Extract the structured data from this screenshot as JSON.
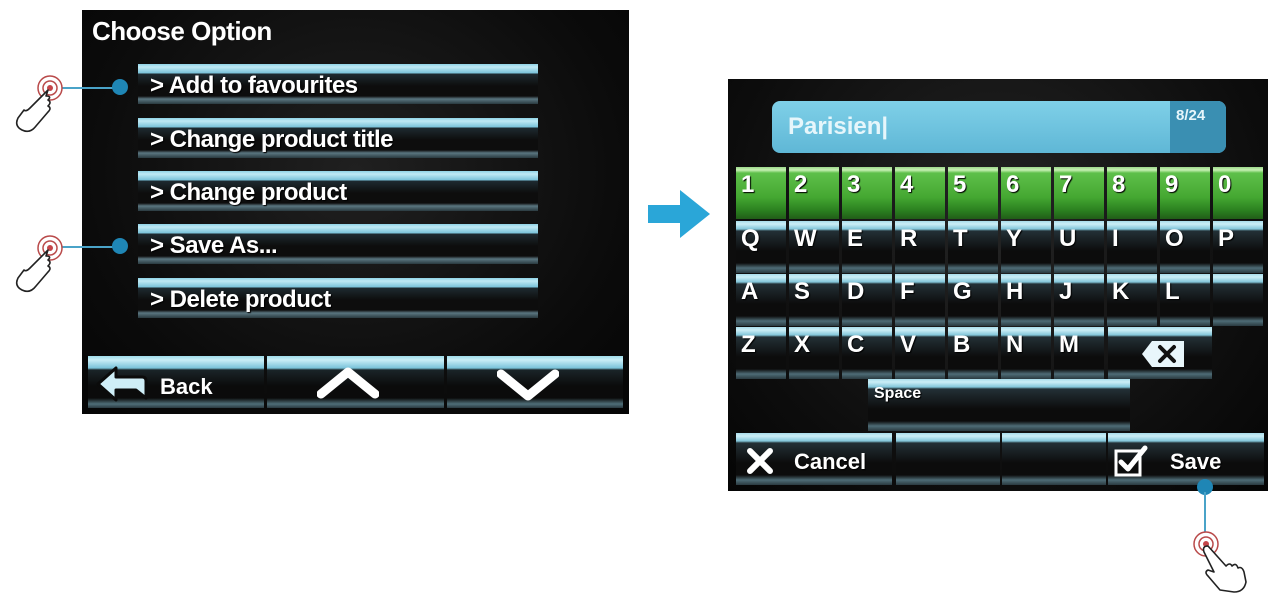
{
  "screen1": {
    "title": "Choose Option",
    "menu_items": [
      {
        "label": "> Add to favourites"
      },
      {
        "label": "> Change product title"
      },
      {
        "label": "> Change product"
      },
      {
        "label": "> Save As..."
      },
      {
        "label": "> Delete product"
      }
    ],
    "nav": {
      "back_label": "Back",
      "up_icon": "chevron-up-icon",
      "down_icon": "chevron-down-icon",
      "back_icon": "back-arrow-icon"
    }
  },
  "keyboard": {
    "input_value": "Parisien|",
    "char_count": "8/24",
    "row_numbers": [
      "1",
      "2",
      "3",
      "4",
      "5",
      "6",
      "7",
      "8",
      "9",
      "0"
    ],
    "row1": [
      "Q",
      "W",
      "E",
      "R",
      "T",
      "Y",
      "U",
      "I",
      "O",
      "P"
    ],
    "row2": [
      "A",
      "S",
      "D",
      "F",
      "G",
      "H",
      "J",
      "K",
      "L"
    ],
    "row3": [
      "Z",
      "X",
      "C",
      "V",
      "B",
      "N",
      "M"
    ],
    "space_label": "Space",
    "cancel_label": "Cancel",
    "save_label": "Save",
    "backspace_icon": "backspace-icon",
    "cancel_icon": "x-icon",
    "save_icon": "checkbox-icon"
  },
  "colors": {
    "accent_blue": "#7fd0e8",
    "key_green": "#45a832",
    "callout": "#1f86b5",
    "arrow": "#2aa6d8"
  }
}
